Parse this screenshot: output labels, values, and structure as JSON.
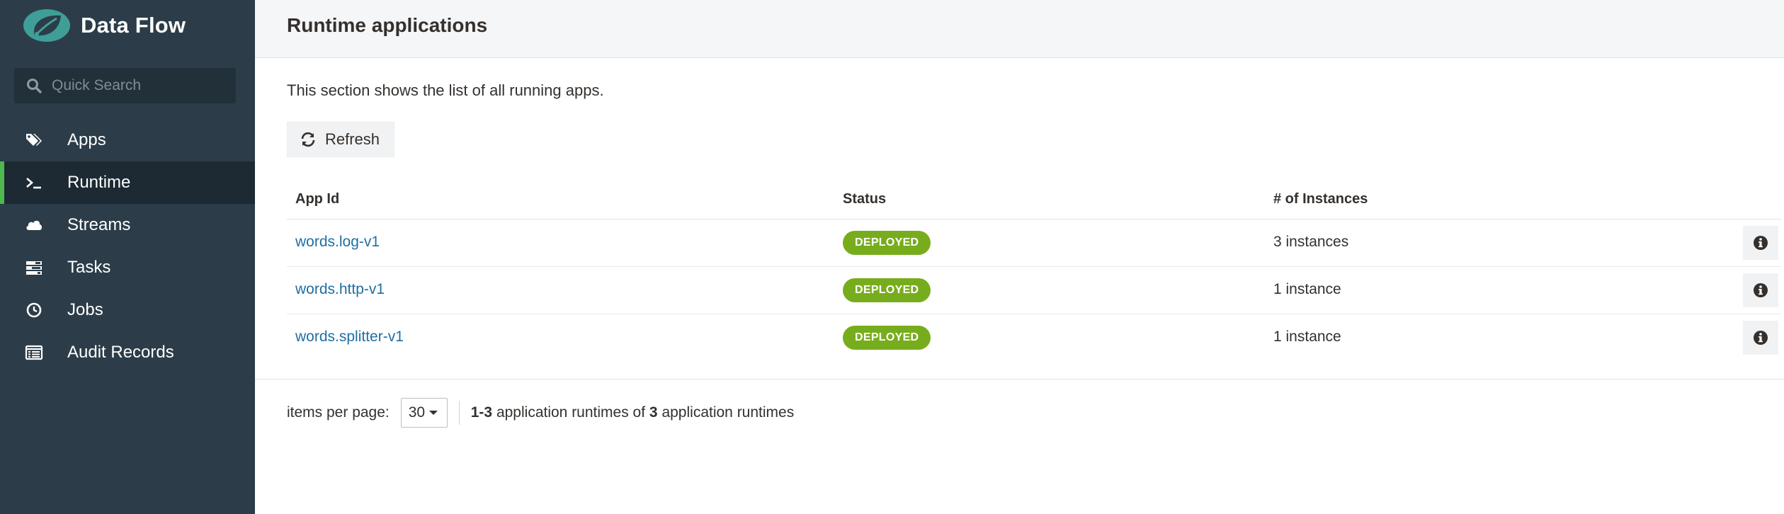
{
  "brand": {
    "title": "Data Flow",
    "logo_icon": "spring-leaf-logo-icon",
    "accent": "#4eb84e"
  },
  "search": {
    "placeholder": "Quick Search"
  },
  "sidebar": {
    "items": [
      {
        "label": "Apps",
        "icon": "tags-icon",
        "active": false
      },
      {
        "label": "Runtime",
        "icon": "terminal-icon",
        "active": true
      },
      {
        "label": "Streams",
        "icon": "cloud-icon",
        "active": false
      },
      {
        "label": "Tasks",
        "icon": "tasks-icon",
        "active": false
      },
      {
        "label": "Jobs",
        "icon": "clock-icon",
        "active": false
      },
      {
        "label": "Audit Records",
        "icon": "list-alt-icon",
        "active": false
      }
    ]
  },
  "header": {
    "title": "Runtime applications"
  },
  "main": {
    "intro": "This section shows the list of all running apps.",
    "refresh_label": "Refresh"
  },
  "table": {
    "headers": {
      "app_id": "App Id",
      "status": "Status",
      "instances": "# of Instances"
    },
    "rows": [
      {
        "app_id": "words.log-v1",
        "status": "DEPLOYED",
        "instances": "3 instances"
      },
      {
        "app_id": "words.http-v1",
        "status": "DEPLOYED",
        "instances": "1 instance"
      },
      {
        "app_id": "words.splitter-v1",
        "status": "DEPLOYED",
        "instances": "1 instance"
      }
    ],
    "status_color": "#77ad1c"
  },
  "pager": {
    "items_per_page_label": "items per page:",
    "page_size": "30",
    "range": "1-3",
    "text_middle": "application runtimes of",
    "total": "3",
    "text_end": "application runtimes"
  }
}
